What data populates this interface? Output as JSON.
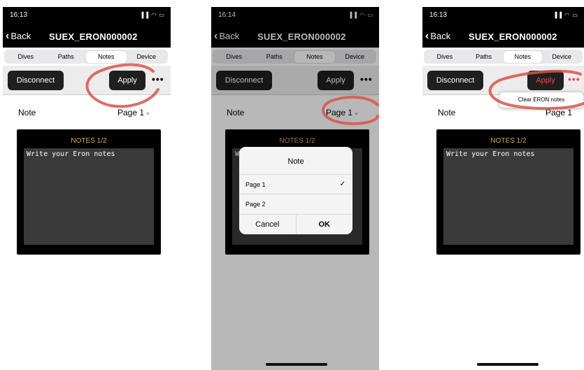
{
  "panels": [
    {
      "status_time": "16:13",
      "status_right": "▐▐ ◠ ▭",
      "back_label": "Back",
      "title": "SUEX_ERON000002",
      "tabs": [
        "Dives",
        "Paths",
        "Notes",
        "Device"
      ],
      "active_tab": "Notes",
      "disconnect_label": "Disconnect",
      "apply_label": "Apply",
      "more_label": "•••",
      "note_label": "Note",
      "page_value": "Page 1",
      "notes_title": "NOTES 1/2",
      "notes_text": "Write your Eron notes"
    },
    {
      "status_time": "16:14",
      "status_right": "▐▐ ◠ ▭",
      "back_label": "Back",
      "title": "SUEX_ERON000002",
      "tabs": [
        "Dives",
        "Paths",
        "Notes",
        "Device"
      ],
      "active_tab": "Notes",
      "disconnect_label": "Disconnect",
      "apply_label": "Apply",
      "more_label": "•••",
      "note_label": "Note",
      "page_value": "Page 1",
      "notes_title": "NOTES 1/2",
      "notes_text": "Wr",
      "dialog": {
        "title": "Note",
        "options": [
          "Page 1",
          "Page 2"
        ],
        "selected": "Page 1",
        "cancel_label": "Cancel",
        "ok_label": "OK"
      }
    },
    {
      "status_time": "16:13",
      "status_right": "▐▐ ◠ ▭",
      "back_label": "Back",
      "title": "SUEX_ERON000002",
      "tabs": [
        "Dives",
        "Paths",
        "Notes",
        "Device"
      ],
      "active_tab": "Notes",
      "disconnect_label": "Disconnect",
      "apply_label": "Apply",
      "more_label": "•••",
      "note_label": "Note",
      "page_value": "Page 1",
      "notes_title": "NOTES 1/2",
      "notes_text": "Write your Eron notes",
      "menu_item": "Clear ERON notes"
    }
  ],
  "colors": {
    "bar": "#000000",
    "button": "#1f1f1f",
    "notes_title": "#d2a851",
    "annotation": "#d9534a"
  }
}
